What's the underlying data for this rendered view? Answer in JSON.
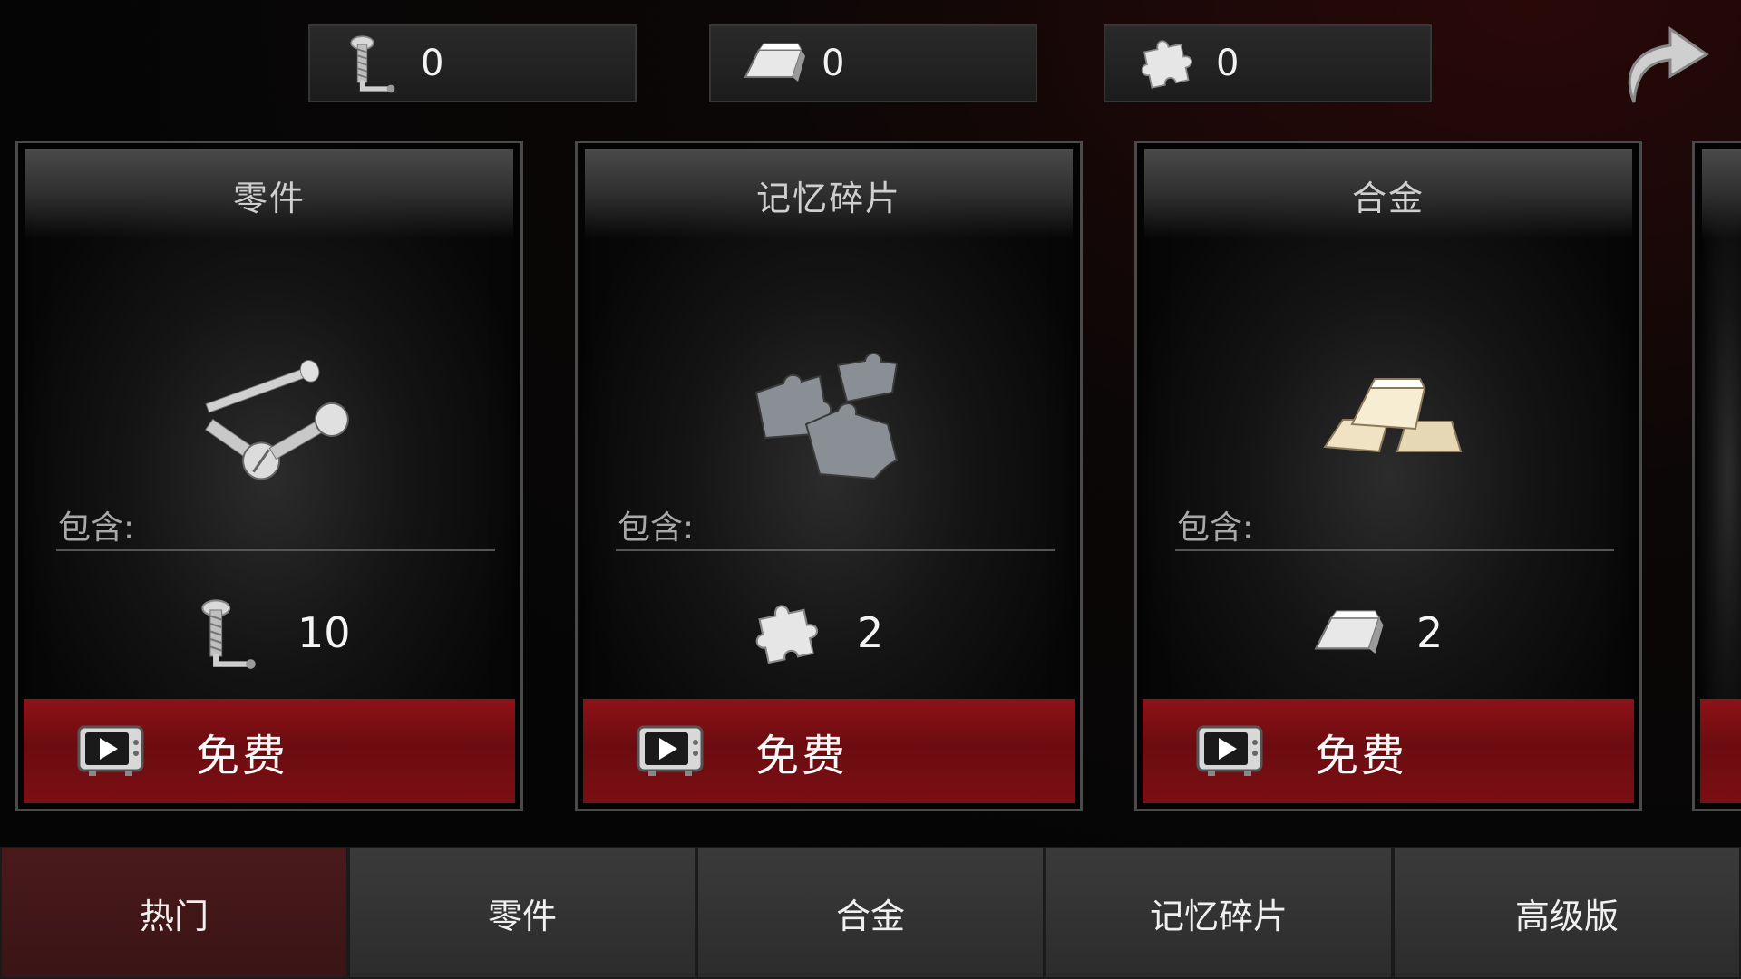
{
  "currencies": [
    {
      "id": "screws",
      "icon": "screw-icon",
      "value": "0"
    },
    {
      "id": "alloy",
      "icon": "alloy-bar-icon",
      "value": "0"
    },
    {
      "id": "memory",
      "icon": "puzzle-piece-icon",
      "value": "0"
    }
  ],
  "back": {
    "icon": "back-arrow-icon"
  },
  "cards": [
    {
      "title": "零件",
      "contains": "包含:",
      "art": "screws-art",
      "reward_icon": "screw-icon",
      "reward_value": "10",
      "button_label": "免费",
      "button_icon": "tv-play-icon"
    },
    {
      "title": "记忆碎片",
      "contains": "包含:",
      "art": "puzzle-pieces-art",
      "reward_icon": "puzzle-piece-icon",
      "reward_value": "2",
      "button_label": "免费",
      "button_icon": "tv-play-icon"
    },
    {
      "title": "合金",
      "contains": "包含:",
      "art": "alloy-bars-art",
      "reward_icon": "alloy-bar-icon",
      "reward_value": "2",
      "button_label": "免费",
      "button_icon": "tv-play-icon"
    }
  ],
  "tabs": [
    {
      "label": "热门",
      "active": true
    },
    {
      "label": "零件",
      "active": false
    },
    {
      "label": "合金",
      "active": false
    },
    {
      "label": "记忆碎片",
      "active": false
    },
    {
      "label": "高级版",
      "active": false
    }
  ],
  "colors": {
    "accent_red": "#8e1218",
    "active_tab": "#4a1a1b",
    "tab_bg": "#333333"
  }
}
